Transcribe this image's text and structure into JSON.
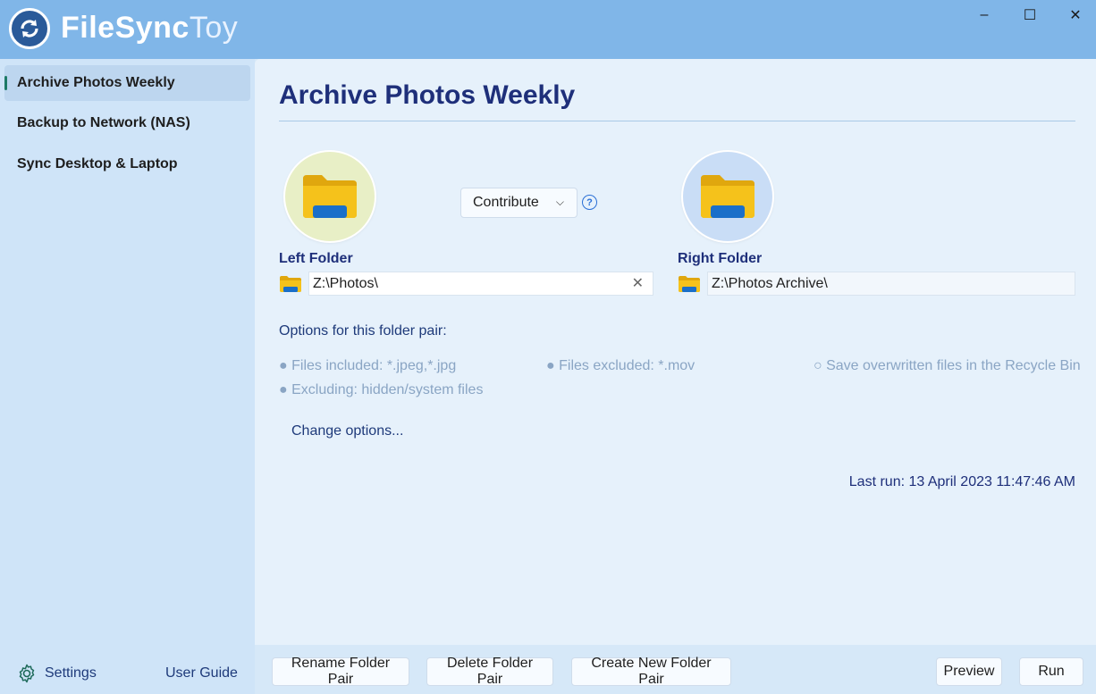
{
  "app": {
    "title_bold": "FileSync",
    "title_light": "Toy",
    "window_controls": {
      "minimize": "–",
      "maximize": "☐",
      "close": "✕"
    }
  },
  "sidebar": {
    "items": [
      {
        "label": "Archive Photos Weekly",
        "selected": true
      },
      {
        "label": "Backup to Network (NAS)",
        "selected": false
      },
      {
        "label": "Sync Desktop & Laptop",
        "selected": false
      }
    ],
    "settings_label": "Settings",
    "user_guide_label": "User Guide"
  },
  "main": {
    "title": "Archive Photos Weekly",
    "mode": {
      "value": "Contribute",
      "help_glyph": "?"
    },
    "left_folder": {
      "label": "Left Folder",
      "path": "Z:\\Photos\\",
      "clear_glyph": "✕"
    },
    "right_folder": {
      "label": "Right Folder",
      "path": "Z:\\Photos Archive\\"
    },
    "options": {
      "heading": "Options for this folder pair:",
      "files_included": "● Files included: *.jpeg,*.jpg",
      "files_excluded": "● Files excluded: *.mov",
      "recycle_bin": "○ Save overwritten files in the Recycle Bin",
      "excluding": "● Excluding: hidden/system files"
    },
    "change_options": "Change options...",
    "last_run": "Last run: 13 April 2023 11:47:46 AM"
  },
  "buttons": {
    "rename": "Rename Folder Pair",
    "delete": "Delete Folder Pair",
    "create": "Create New Folder Pair",
    "preview": "Preview",
    "run": "Run"
  },
  "colors": {
    "titlebar": "#80b6e8",
    "sidebar": "#cfe4f8",
    "main": "#e6f1fb",
    "heading": "#1e2f7a",
    "left_badge": "#e8efc6",
    "right_badge": "#c9ddf6",
    "folder_yellow": "#f5c21b",
    "folder_blue": "#1a6fc9"
  },
  "icons": {
    "app_logo": "sync-arrows-icon",
    "settings": "gear-icon",
    "folder": "folder-icon",
    "help": "question-circle-icon",
    "dropdown": "chevron-down-icon"
  }
}
